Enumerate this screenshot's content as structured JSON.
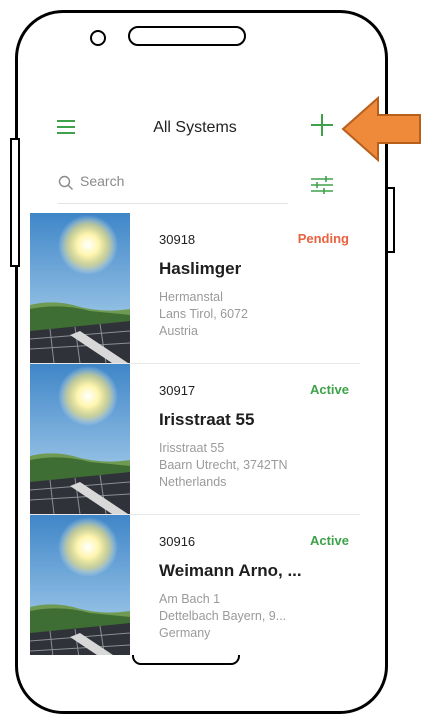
{
  "header": {
    "title": "All Systems"
  },
  "search": {
    "placeholder": "Search"
  },
  "systems": [
    {
      "id": "30918",
      "status": "Pending",
      "name": "Haslimger",
      "address": [
        "Hermanstal",
        "Lans Tirol, 6072",
        "Austria"
      ]
    },
    {
      "id": "30917",
      "status": "Active",
      "name": "Irisstraat 55",
      "address": [
        "Irisstraat 55",
        "Baarn Utrecht, 3742TN",
        "Netherlands"
      ]
    },
    {
      "id": "30916",
      "status": "Active",
      "name": "Weimann Arno, ...",
      "address": [
        "Am Bach 1",
        "Dettelbach Bayern, 9...",
        "Germany"
      ]
    }
  ],
  "colors": {
    "accent": "#3ea24a",
    "pending": "#e8623f",
    "callout_arrow": "#ee8a3a"
  },
  "icons": {
    "menu": "hamburger-icon",
    "add": "plus-icon",
    "search": "search-icon",
    "filter": "filter-sliders-icon"
  }
}
